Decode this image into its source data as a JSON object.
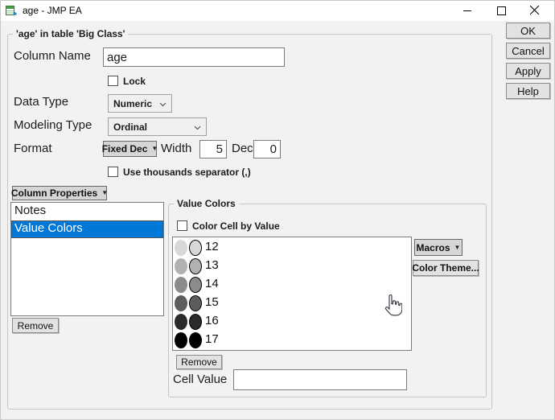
{
  "window": {
    "title": "age - JMP EA"
  },
  "colors": {
    "selection_blue": "#0078d7",
    "titlebar_bg": "#ffffff",
    "dialog_bg": "#f2f2f2"
  },
  "outer_group": {
    "title": "'age' in table 'Big Class'"
  },
  "fields": {
    "column_name_label": "Column Name",
    "column_name_value": "age",
    "lock_label": "Lock",
    "lock_checked": false,
    "data_type_label": "Data Type",
    "data_type_value": "Numeric",
    "modeling_type_label": "Modeling Type",
    "modeling_type_value": "Ordinal",
    "format_label": "Format",
    "format_value": "Fixed Dec",
    "width_label": "Width",
    "width_value": "5",
    "dec_label": "Dec",
    "dec_value": "0",
    "thousands_label": "Use thousands separator (,)",
    "thousands_checked": false
  },
  "properties_panel": {
    "dropdown_label": "Column Properties",
    "items": [
      {
        "label": "Notes",
        "selected": false
      },
      {
        "label": "Value Colors",
        "selected": true
      }
    ],
    "remove_label": "Remove"
  },
  "value_colors": {
    "group_title": "Value Colors",
    "color_cell_label": "Color Cell by Value",
    "color_cell_checked": false,
    "rows": [
      {
        "value": "12",
        "color": "#d8d8d8"
      },
      {
        "value": "13",
        "color": "#b1b1b1"
      },
      {
        "value": "14",
        "color": "#8b8b8b"
      },
      {
        "value": "15",
        "color": "#5d5d5d"
      },
      {
        "value": "16",
        "color": "#2a2a2a"
      },
      {
        "value": "17",
        "color": "#000000"
      }
    ],
    "macros_label": "Macros",
    "color_theme_label": "Color Theme...",
    "remove_label": "Remove",
    "cell_value_label": "Cell Value",
    "cell_value_text": ""
  },
  "action_buttons": {
    "ok": "OK",
    "cancel": "Cancel",
    "apply": "Apply",
    "help": "Help"
  }
}
